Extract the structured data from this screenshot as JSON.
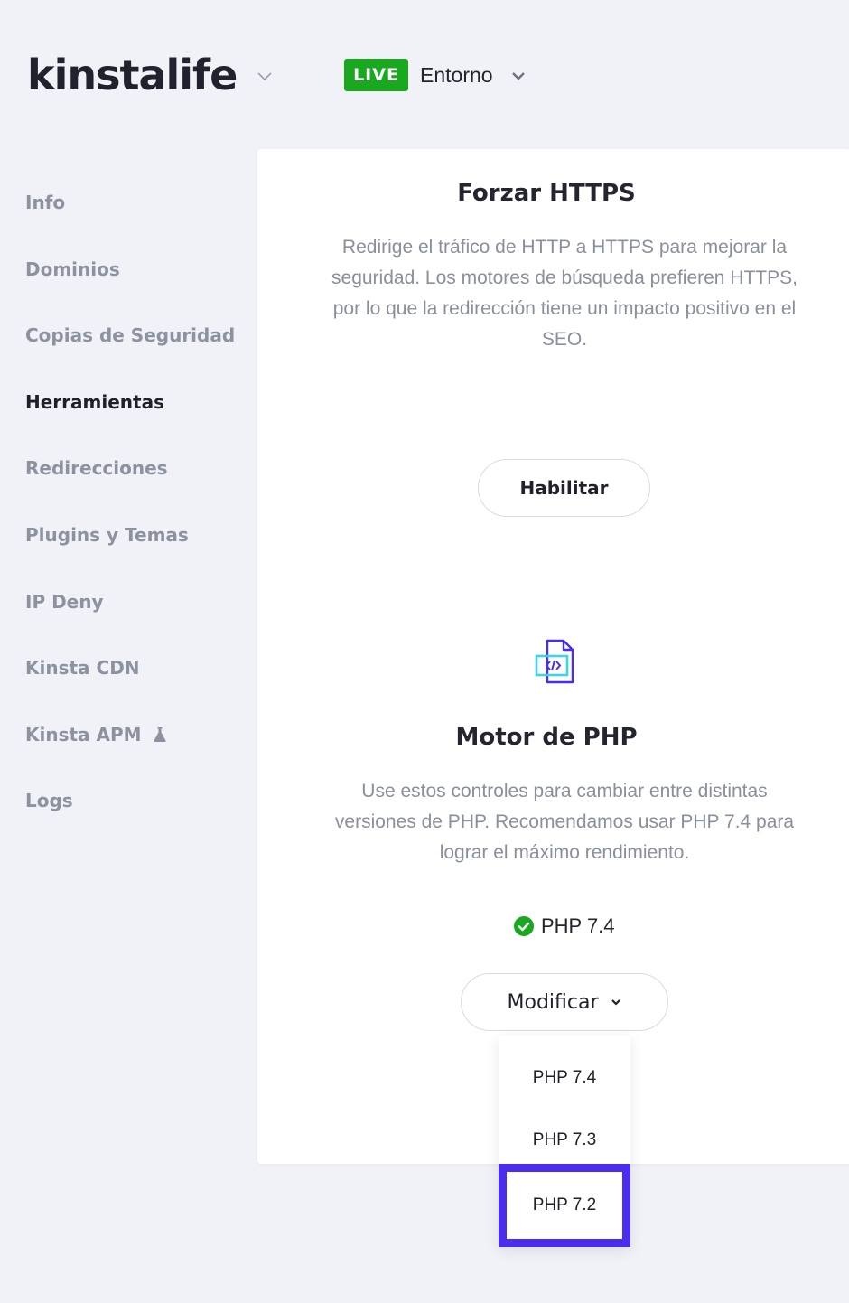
{
  "header": {
    "logo_text": "kinstalife",
    "environment_badge": "LIVE",
    "environment_label": "Entorno"
  },
  "sidebar": {
    "items": [
      {
        "label": "Info"
      },
      {
        "label": "Dominios"
      },
      {
        "label": "Copias de Seguridad"
      },
      {
        "label": "Herramientas",
        "active": true
      },
      {
        "label": "Redirecciones"
      },
      {
        "label": "Plugins y Temas"
      },
      {
        "label": "IP Deny"
      },
      {
        "label": "Kinsta CDN"
      },
      {
        "label": "Kinsta APM",
        "icon": "flask-icon"
      },
      {
        "label": "Logs"
      }
    ]
  },
  "https_section": {
    "title": "Forzar HTTPS",
    "description": "Redirige el tráfico de HTTP a HTTPS para mejorar la seguridad. Los motores de búsqueda prefieren HTTPS, por lo que la redirección tiene un impacto positivo en el SEO.",
    "button_label": "Habilitar"
  },
  "php_section": {
    "icon": "php-code-file-icon",
    "title": "Motor de PHP",
    "description": "Use estos controles para cambiar entre distintas versiones de PHP. Recomendamos usar PHP 7.4 para lograr el máximo rendimiento.",
    "current_version": "PHP 7.4",
    "modify_button_label": "Modificar",
    "dropdown_options": [
      "PHP 7.4",
      "PHP 7.3",
      "PHP 7.2"
    ],
    "highlighted_option": "PHP 7.2"
  },
  "colors": {
    "live_badge": "#19a81f",
    "highlight_border": "#4b2df0",
    "page_background": "#f0f2f7",
    "check": "#19a81f"
  }
}
